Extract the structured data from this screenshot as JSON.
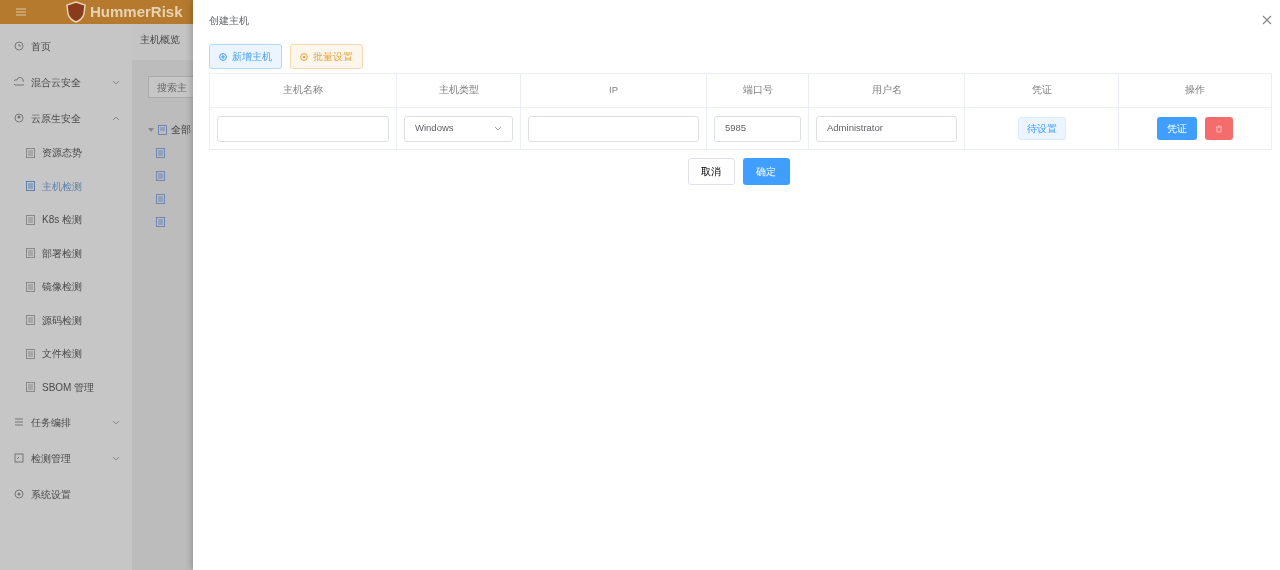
{
  "app": {
    "logo_text": "HummerRisk"
  },
  "sidebar": {
    "items": [
      {
        "label": "首页",
        "selected": false
      },
      {
        "label": "混合云安全",
        "selected": false,
        "expanded": false
      },
      {
        "label": "云原生安全",
        "selected": false,
        "expanded": true,
        "children": [
          {
            "label": "资源态势",
            "selected": false
          },
          {
            "label": "主机检测",
            "selected": true
          },
          {
            "label": "K8s 检测",
            "selected": false
          },
          {
            "label": "部署检测",
            "selected": false
          },
          {
            "label": "镜像检测",
            "selected": false
          },
          {
            "label": "源码检测",
            "selected": false
          },
          {
            "label": "文件检测",
            "selected": false
          },
          {
            "label": "SBOM 管理",
            "selected": false
          }
        ]
      },
      {
        "label": "任务编排",
        "selected": false,
        "expanded": false
      },
      {
        "label": "检测管理",
        "selected": false,
        "expanded": false
      },
      {
        "label": "系统设置",
        "selected": false
      }
    ]
  },
  "background_panel": {
    "tab": "主机概览",
    "search": {
      "placeholder": "搜索主"
    },
    "tree": {
      "root": "全部",
      "expanded": true
    }
  },
  "drawer": {
    "title": "创建主机",
    "toolbar": [
      "新增主机",
      "批量设置"
    ],
    "table": {
      "columns": [
        "主机名称",
        "主机类型",
        "IP",
        "端口号",
        "用户名",
        "凭证",
        "操作"
      ],
      "rows": [
        {
          "host_type": "Windows",
          "port": "5985",
          "username": "Administrator",
          "credential_status": "待设置",
          "action_button": "凭证"
        }
      ]
    },
    "footer": {
      "cancel": "取消",
      "confirm": "确定"
    }
  }
}
